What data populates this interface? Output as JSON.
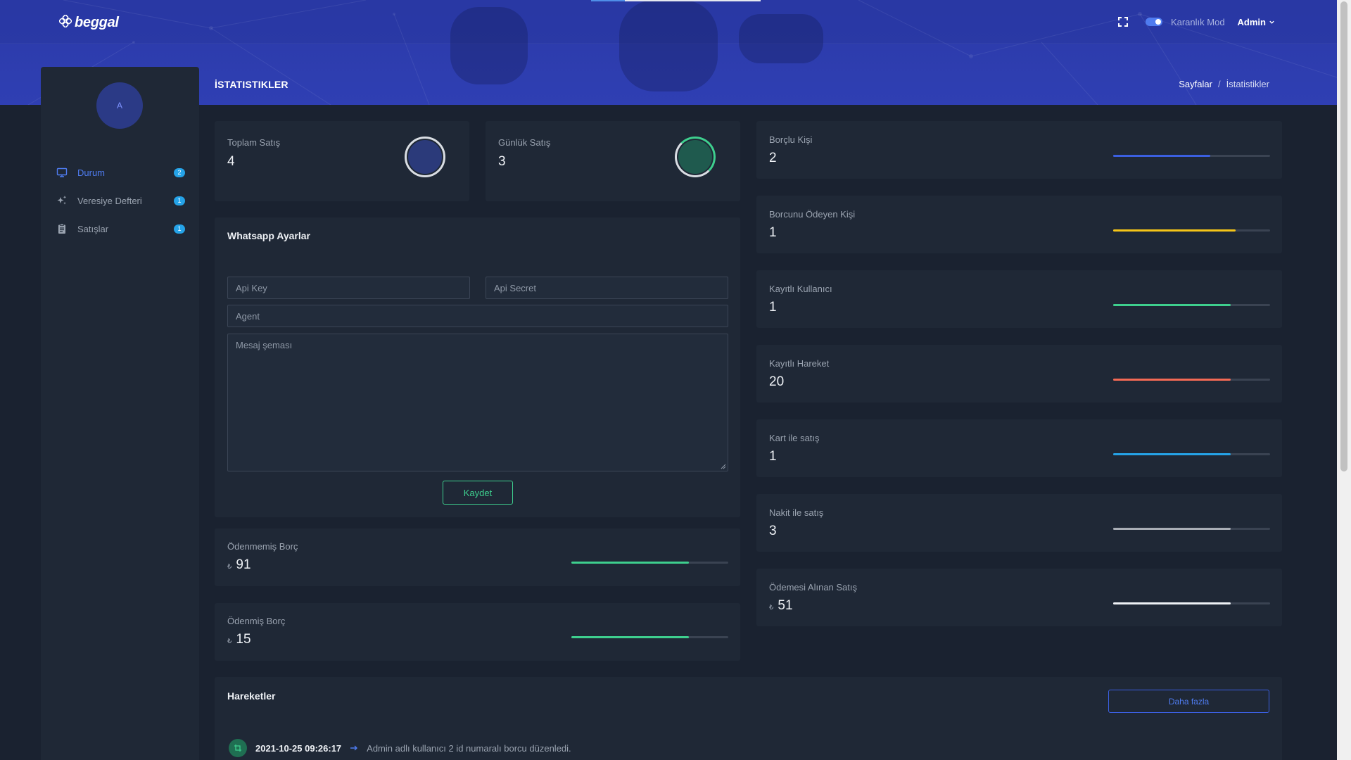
{
  "brand": {
    "name": "beggal"
  },
  "nav": {
    "dark_mode_label": "Karanlık Mod",
    "user_label": "Admin"
  },
  "page": {
    "title": "İSTATISTIKLER",
    "breadcrumb": [
      "Sayfalar",
      "İstatistikler"
    ]
  },
  "sidebar": {
    "avatar_initial": "A",
    "items": [
      {
        "label": "Durum",
        "badge": "2",
        "icon": "monitor-icon",
        "active": true
      },
      {
        "label": "Veresiye Defteri",
        "badge": "1",
        "icon": "sparkles-icon",
        "active": false
      },
      {
        "label": "Satışlar",
        "badge": "1",
        "icon": "clipboard-icon",
        "active": false
      }
    ]
  },
  "stats_top": [
    {
      "label": "Toplam Satış",
      "value": "4",
      "ring_color": "#d9dde3"
    },
    {
      "label": "Günlük Satış",
      "value": "3",
      "ring_color": "#3ecf8e"
    }
  ],
  "whatsapp": {
    "title": "Whatsapp Ayarlar",
    "api_key_placeholder": "Api Key",
    "api_secret_placeholder": "Api Secret",
    "agent_placeholder": "Agent",
    "message_placeholder": "Mesaj şeması",
    "save_label": "Kaydet"
  },
  "debts": [
    {
      "label": "Ödenmemiş Borç",
      "currency": "₺",
      "value": "91",
      "progress": 0.75,
      "color": "#3ecf8e"
    },
    {
      "label": "Ödenmiş Borç",
      "currency": "₺",
      "value": "15",
      "progress": 0.75,
      "color": "#3ecf8e"
    }
  ],
  "right_stats": [
    {
      "label": "Borçlu Kişi",
      "value": "2",
      "currency": "",
      "progress": 0.62,
      "color": "#3b5fe0"
    },
    {
      "label": "Borcunu Ödeyen Kişi",
      "value": "1",
      "currency": "",
      "progress": 0.78,
      "color": "#f5c518"
    },
    {
      "label": "Kayıtlı Kullanıcı",
      "value": "1",
      "currency": "",
      "progress": 0.75,
      "color": "#3ecf8e"
    },
    {
      "label": "Kayıtlı Hareket",
      "value": "20",
      "currency": "",
      "progress": 0.75,
      "color": "#f46a55"
    },
    {
      "label": "Kart ile satış",
      "value": "1",
      "currency": "",
      "progress": 0.75,
      "color": "#25a3e8"
    },
    {
      "label": "Nakit ile satış",
      "value": "3",
      "currency": "",
      "progress": 0.75,
      "color": "#a9aeb6"
    },
    {
      "label": "Ödemesi Alınan Satış",
      "value": "51",
      "currency": "₺",
      "progress": 0.75,
      "color": "#eef1f5"
    }
  ],
  "movements": {
    "title": "Hareketler",
    "more_label": "Daha fazla",
    "items": [
      {
        "time": "2021-10-25 09:26:17",
        "text": "Admin adlı kullanıcı 2 id numaralı borcu düzenledi."
      }
    ]
  }
}
